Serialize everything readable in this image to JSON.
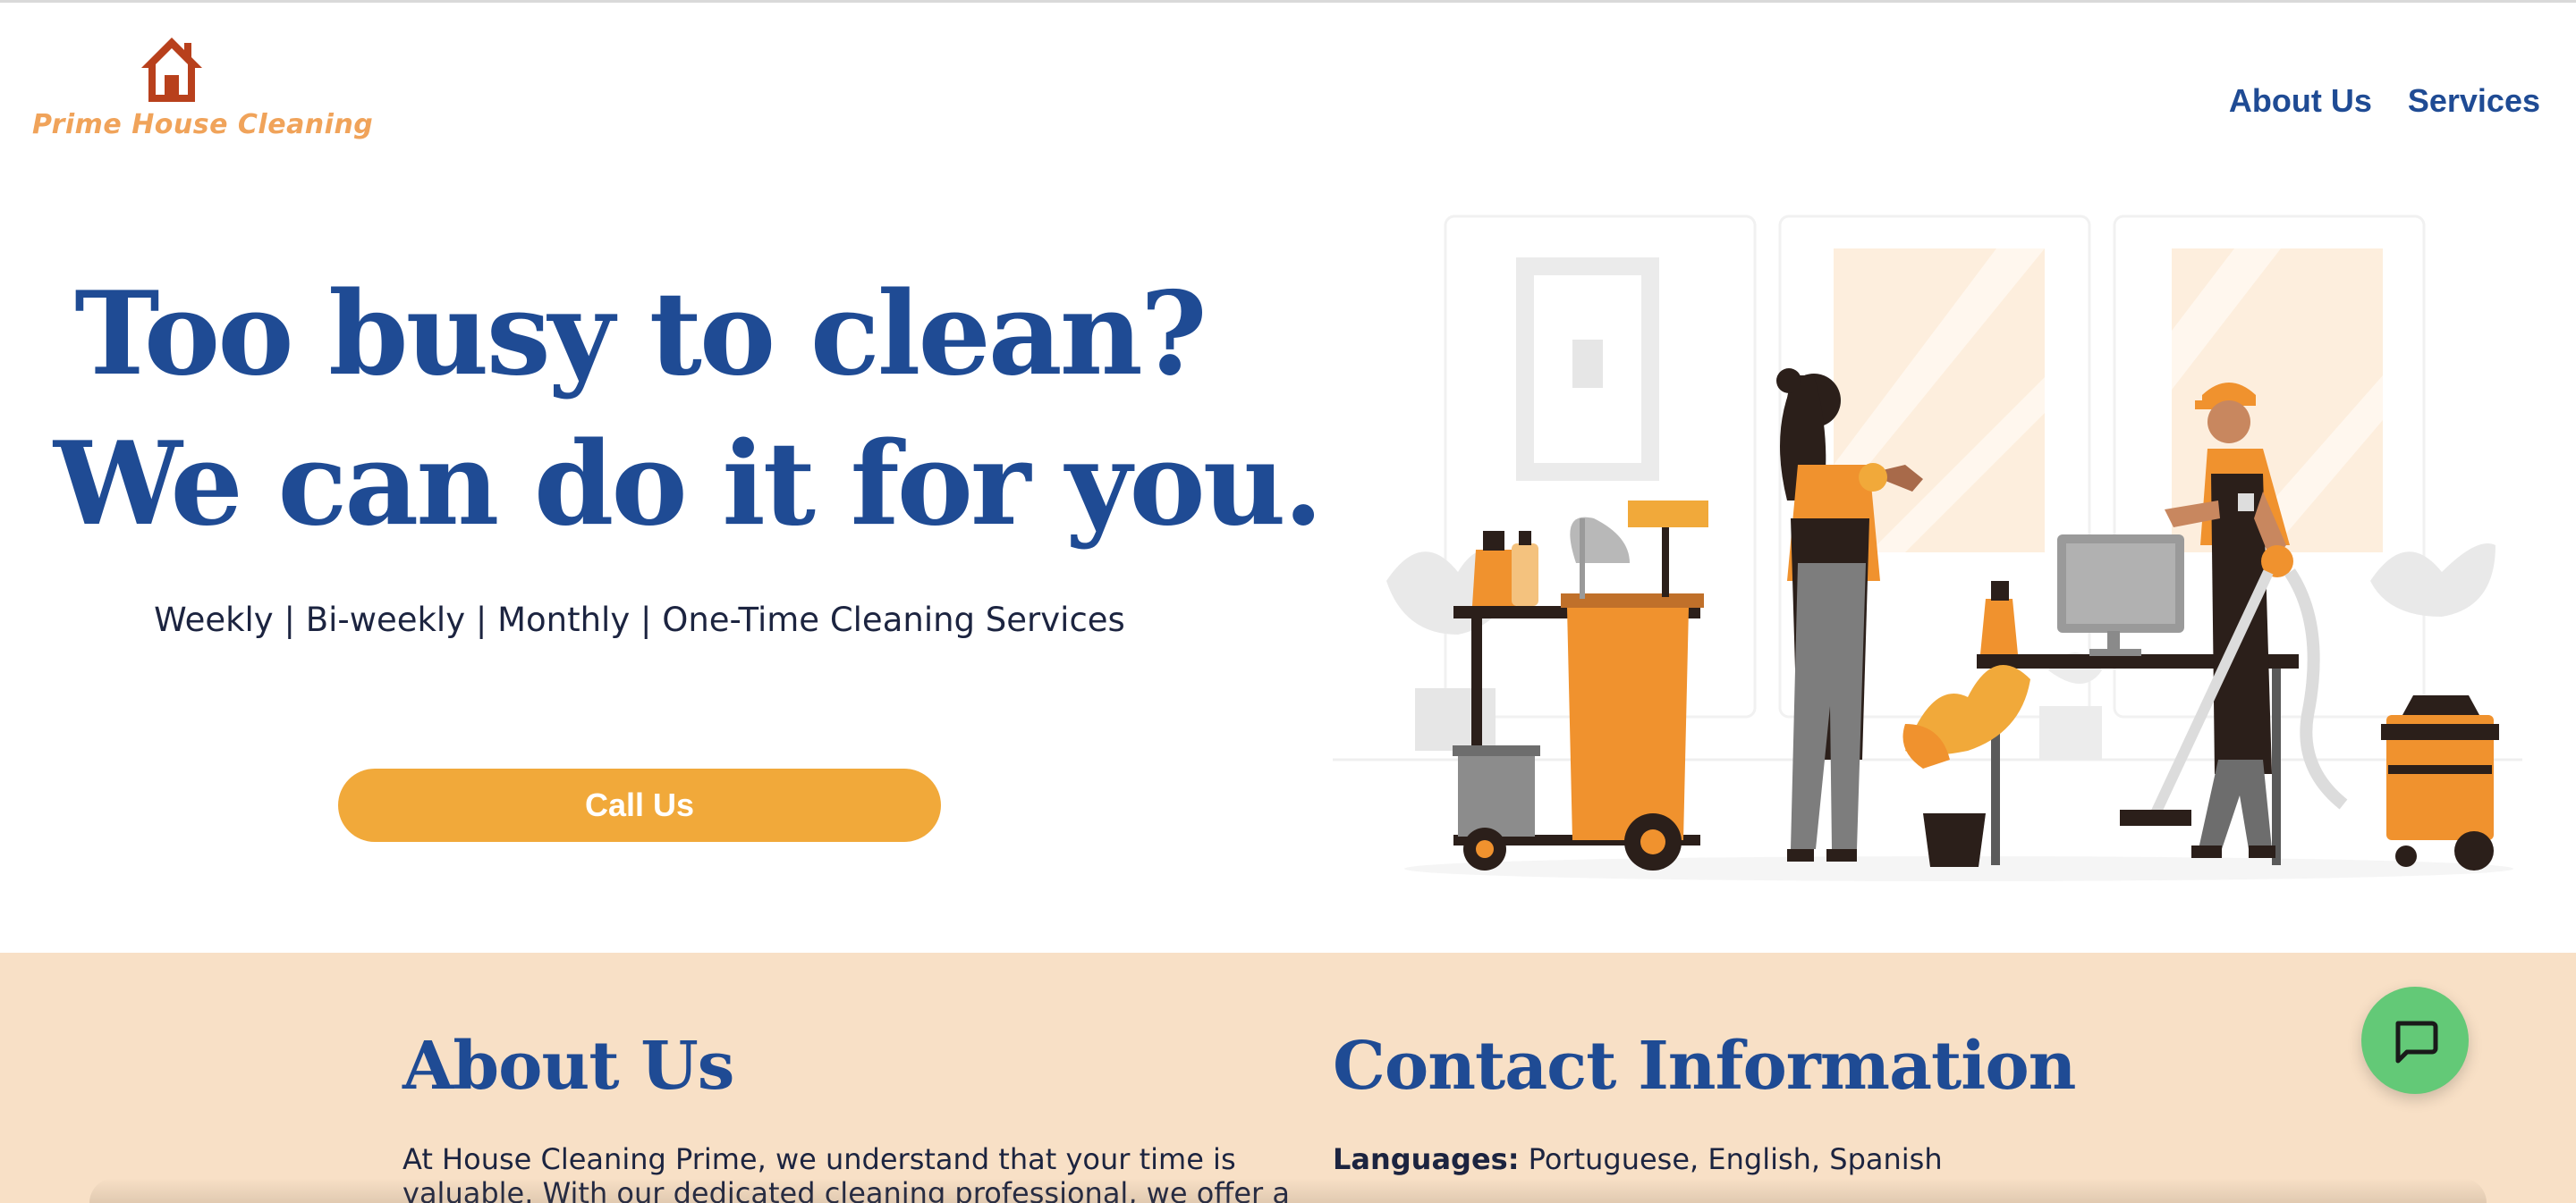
{
  "brand": {
    "name": "Prime House Cleaning",
    "logo_icon": "house-icon",
    "color": "#f0a35a",
    "icon_color": "#b8401c"
  },
  "nav": {
    "items": [
      "About Us",
      "Services"
    ]
  },
  "hero": {
    "title_line1": "Too busy to clean?",
    "title_line2": "We can do it for you.",
    "subtitle": "Weekly | Bi-weekly | Monthly | One-Time Cleaning Services",
    "cta_label": "Call Us"
  },
  "about": {
    "title": "About Us",
    "text": "At House Cleaning Prime, we understand that your time is valuable. With our dedicated cleaning professional, we offer a"
  },
  "contact": {
    "title": "Contact Information",
    "languages_label": "Languages:",
    "languages_value": "Portuguese, English, Spanish"
  },
  "chat": {
    "icon": "chat-bubble-icon"
  },
  "colors": {
    "primary": "#1f4b94",
    "accent": "#f1a93a",
    "peach": "#f8e0c6",
    "chat": "#63c977"
  }
}
